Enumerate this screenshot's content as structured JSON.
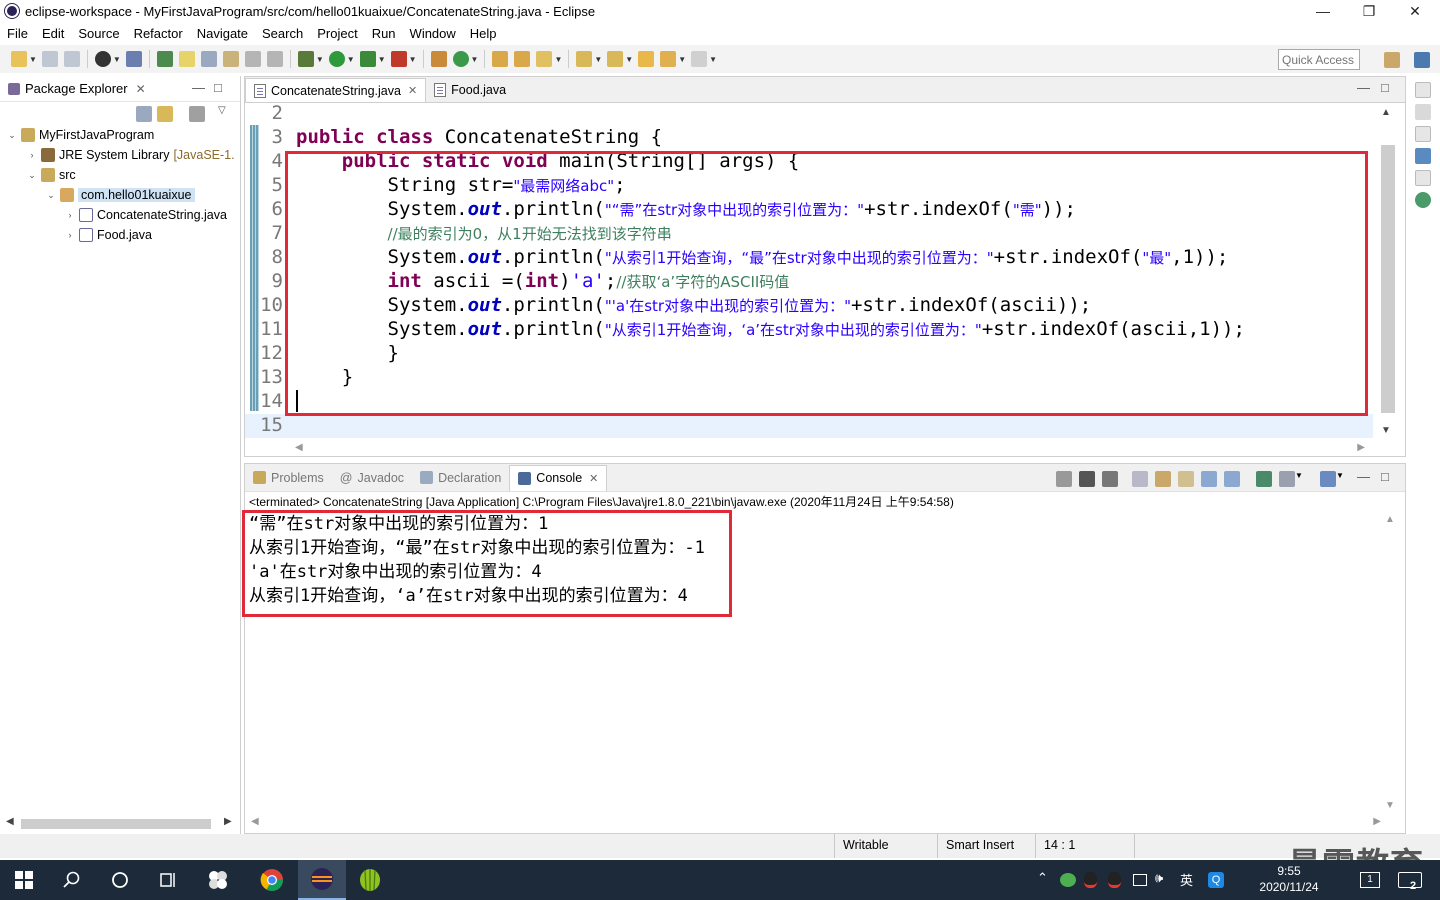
{
  "window": {
    "title": "eclipse-workspace - MyFirstJavaProgram/src/com/hello01kuaixue/ConcatenateString.java - Eclipse",
    "minimize": "—",
    "maximize": "❐",
    "close": "✕"
  },
  "menu": [
    "File",
    "Edit",
    "Source",
    "Refactor",
    "Navigate",
    "Search",
    "Project",
    "Run",
    "Window",
    "Help"
  ],
  "toolbar": {
    "quick_access_placeholder": "Quick Access"
  },
  "package_explorer": {
    "title": "Package Explorer",
    "tree": [
      {
        "label": "MyFirstJavaProgram",
        "expanded": true
      },
      {
        "label": "JRE System Library",
        "decoration": "[JavaSE-1.",
        "expanded": false
      },
      {
        "label": "src",
        "expanded": true
      },
      {
        "label": "com.hello01kuaixue",
        "expanded": true,
        "selected": true
      },
      {
        "label": "ConcatenateString.java",
        "expanded": false
      },
      {
        "label": "Food.java",
        "expanded": false
      }
    ]
  },
  "editor": {
    "tabs": [
      {
        "label": "ConcatenateString.java",
        "active": true
      },
      {
        "label": "Food.java",
        "active": false
      }
    ],
    "line_numbers": [
      "2",
      "3",
      "4",
      "5",
      "6",
      "7",
      "8",
      "9",
      "10",
      "11",
      "12",
      "13",
      "14",
      "15"
    ],
    "lines": {
      "l3": {
        "kw1": "public",
        "kw2": "class",
        "rest": " ConcatenateString {"
      },
      "l4": {
        "kw1": "public",
        "kw2": "static",
        "kw3": "void",
        "rest": " main(String[] args) {"
      },
      "l5": {
        "pre": "String str=",
        "str": "\"最需网络abc\"",
        "post": ";"
      },
      "l6": {
        "pre": "System.",
        "fld": "out",
        "mid": ".println(",
        "str": "\"“需”在str对象中出现的索引位置为：\"",
        "post": "+str.indexOf(",
        "str2": "\"需\"",
        "end": "));"
      },
      "l7": {
        "comment": "//最的索引为0，从1开始无法找到该字符串"
      },
      "l8": {
        "pre": "System.",
        "fld": "out",
        "mid": ".println(",
        "str": "\"从索引1开始查询，“最”在str对象中出现的索引位置为：\"",
        "post": "+str.indexOf(",
        "str2": "\"最\"",
        "end": ",1));"
      },
      "l9": {
        "kw1": "int",
        "mid": " ascii =(",
        "kw2": "int",
        "mid2": ")",
        "chr": "'a'",
        "semi": ";",
        "comment": "//获取‘a’字符的ASCII码值"
      },
      "l10": {
        "pre": "System.",
        "fld": "out",
        "mid": ".println(",
        "str": "\"'a'在str对象中出现的索引位置为：\"",
        "post": "+str.indexOf(ascii));"
      },
      "l11": {
        "pre": "System.",
        "fld": "out",
        "mid": ".println(",
        "str": "\"从索引1开始查询，‘a’在str对象中出现的索引位置为：\"",
        "post": "+str.indexOf(ascii,1));"
      },
      "l12": {
        "text": "}"
      },
      "l13": {
        "text": "}"
      }
    }
  },
  "console": {
    "tabs": [
      "Problems",
      "Javadoc",
      "Declaration",
      "Console"
    ],
    "active_tab": "Console",
    "terminated": "<terminated> ConcatenateString [Java Application] C:\\Program Files\\Java\\jre1.8.0_221\\bin\\javaw.exe (2020年11月24日 上午9:54:58)",
    "output": [
      "“需”在str对象中出现的索引位置为：1",
      "从索引1开始查询，“最”在str对象中出现的索引位置为：-1",
      "'a'在str对象中出现的索引位置为：4",
      "从索引1开始查询，‘a’在str对象中出现的索引位置为：4"
    ]
  },
  "statusbar": {
    "writable": "Writable",
    "insert_mode": "Smart Insert",
    "position": "14 : 1"
  },
  "taskbar": {
    "time": "9:55",
    "date": "2020/11/24",
    "ime": "英",
    "notifications": "2"
  },
  "watermark": "最需教育",
  "colors": {
    "accent_red": "#e02a3a",
    "keyword": "#7f0055",
    "string": "#2a00ff",
    "comment": "#3f7f5f",
    "taskbar": "#1c2a3a"
  }
}
